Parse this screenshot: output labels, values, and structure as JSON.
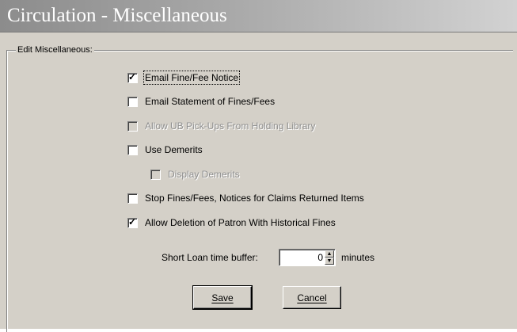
{
  "window": {
    "title": "Circulation - Miscellaneous"
  },
  "group": {
    "legend": "Edit Miscellaneous:"
  },
  "options": [
    {
      "label": "Email Fine/Fee Notice",
      "checked": true,
      "disabled": false
    },
    {
      "label": "Email Statement of Fines/Fees",
      "checked": false,
      "disabled": false
    },
    {
      "label": "Allow UB Pick-Ups From Holding Library",
      "checked": false,
      "disabled": true
    },
    {
      "label": "Use Demerits",
      "checked": false,
      "disabled": false
    },
    {
      "label": "Display Demerits",
      "checked": false,
      "disabled": true
    },
    {
      "label": "Stop Fines/Fees, Notices for Claims Returned Items",
      "checked": false,
      "disabled": false
    },
    {
      "label": "Allow Deletion of Patron With Historical Fines",
      "checked": true,
      "disabled": false
    }
  ],
  "buffer": {
    "label": "Short Loan time buffer:",
    "value": "0",
    "unit": "minutes"
  },
  "buttons": {
    "save": "Save",
    "cancel": "Cancel"
  }
}
